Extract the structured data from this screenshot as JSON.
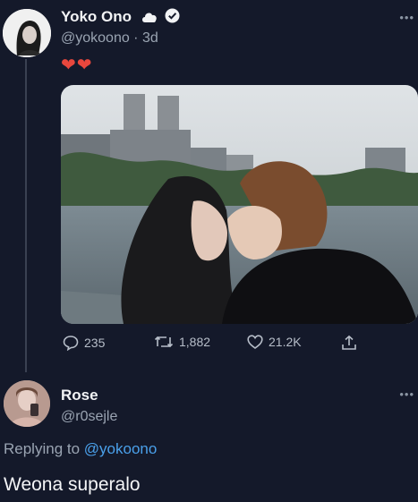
{
  "tweet": {
    "author": "Yoko Ono",
    "handle_line": "@yokoono · 3d",
    "hearts": "❤❤",
    "actions": {
      "replies": "235",
      "retweets": "1,882",
      "likes": "21.2K"
    }
  },
  "reply": {
    "author": "Rose",
    "handle": "@r0sejle",
    "replying_to_prefix": "Replying to",
    "replying_to_handle": "@yokoono",
    "text": "Weona superalo"
  },
  "colors": {
    "background": "#14192a",
    "accent": "#4aa0ea",
    "heart": "#e8473d"
  }
}
